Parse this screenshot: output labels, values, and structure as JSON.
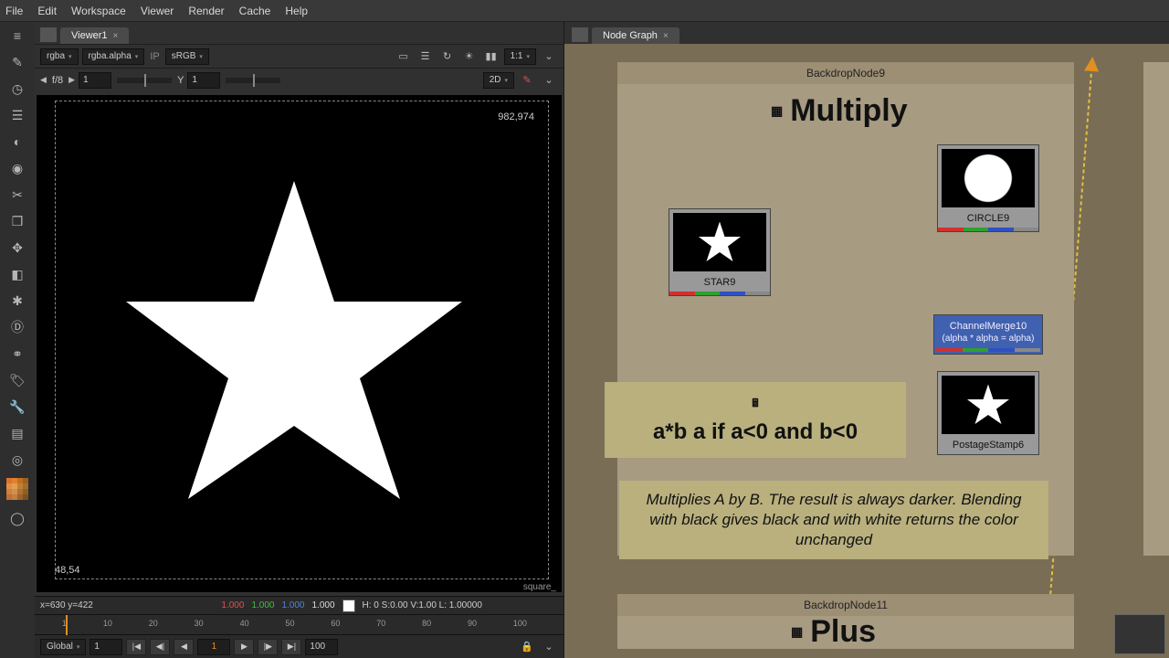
{
  "menu": {
    "file": "File",
    "edit": "Edit",
    "workspace": "Workspace",
    "viewer": "Viewer",
    "render": "Render",
    "cache": "Cache",
    "help": "Help"
  },
  "viewer": {
    "tab": "Viewer1",
    "channel": "rgba",
    "alpha": "rgba.alpha",
    "ip": "IP",
    "colorspace": "sRGB",
    "zoom": "1:1",
    "fstop": "f/8",
    "fval": "1",
    "y_label": "Y",
    "y_val": "1",
    "dims": "2D",
    "top_right": "982,974",
    "bottom_left": "48,54",
    "bottom_right": "square_",
    "status_xy": "x=630 y=422",
    "status_r": "1.000",
    "status_g": "1.000",
    "status_b": "1.000",
    "status_a": "1.000",
    "status_hsv": "H:  0 S:0.00 V:1.00  L: 1.00000"
  },
  "timeline": {
    "start": "1",
    "t10": "10",
    "t20": "20",
    "t30": "30",
    "t40": "40",
    "t50": "50",
    "t60": "60",
    "t70": "70",
    "t80": "80",
    "t90": "90",
    "t100": "100",
    "end": "100"
  },
  "transport": {
    "mode": "Global",
    "frame": "1",
    "startf": "1",
    "endf": "100"
  },
  "nodegraph": {
    "tab": "Node Graph",
    "backdrop9": "BackdropNode9",
    "backdrop11": "BackdropNode11",
    "title_multiply": "Multiply",
    "title_plus": "Plus",
    "star": "STAR9",
    "circle": "CIRCLE9",
    "merge": "ChannelMerge10",
    "merge_expr": "(alpha * alpha = alpha)",
    "postage": "PostageStamp6",
    "formula": "a*b a if a<0 and b<0",
    "desc": "Multiplies A by B. The result is always darker. Blending with black gives black and with white returns the color unchanged"
  }
}
